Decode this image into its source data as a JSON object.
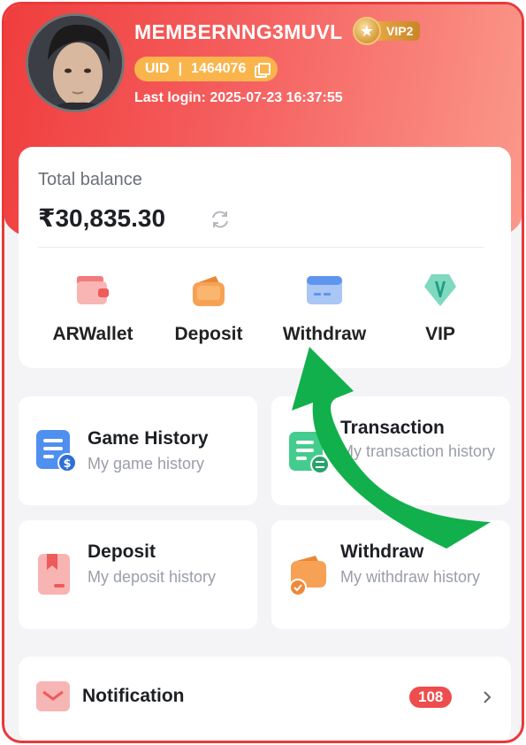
{
  "profile": {
    "username": "MEMBERNNG3MUVL",
    "vip_level": "VIP2",
    "uid_label": "UID",
    "uid_value": "1464076",
    "last_login": "Last login: 2025-07-23 16:37:55"
  },
  "balance": {
    "title": "Total balance",
    "amount": "₹30,835.30"
  },
  "quick_actions": [
    {
      "label": "ARWallet",
      "icon": "wallet-icon"
    },
    {
      "label": "Deposit",
      "icon": "deposit-icon"
    },
    {
      "label": "Withdraw",
      "icon": "withdraw-card-icon"
    },
    {
      "label": "VIP",
      "icon": "vip-diamond-icon"
    }
  ],
  "tiles": [
    {
      "title": "Game History",
      "subtitle": "My game history",
      "icon": "game-history-icon"
    },
    {
      "title": "Transaction",
      "subtitle": "My transaction history",
      "icon": "transaction-icon"
    },
    {
      "title": "Deposit",
      "subtitle": "My deposit history",
      "icon": "deposit-history-icon"
    },
    {
      "title": "Withdraw",
      "subtitle": "My withdraw history",
      "icon": "withdraw-history-icon"
    }
  ],
  "notification": {
    "label": "Notification",
    "count": "108"
  },
  "colors": {
    "brand_red": "#e83a3a",
    "uid_pill": "#f9b54c",
    "annotation_arrow": "#12b04c",
    "badge_red": "#ee4d4d"
  }
}
